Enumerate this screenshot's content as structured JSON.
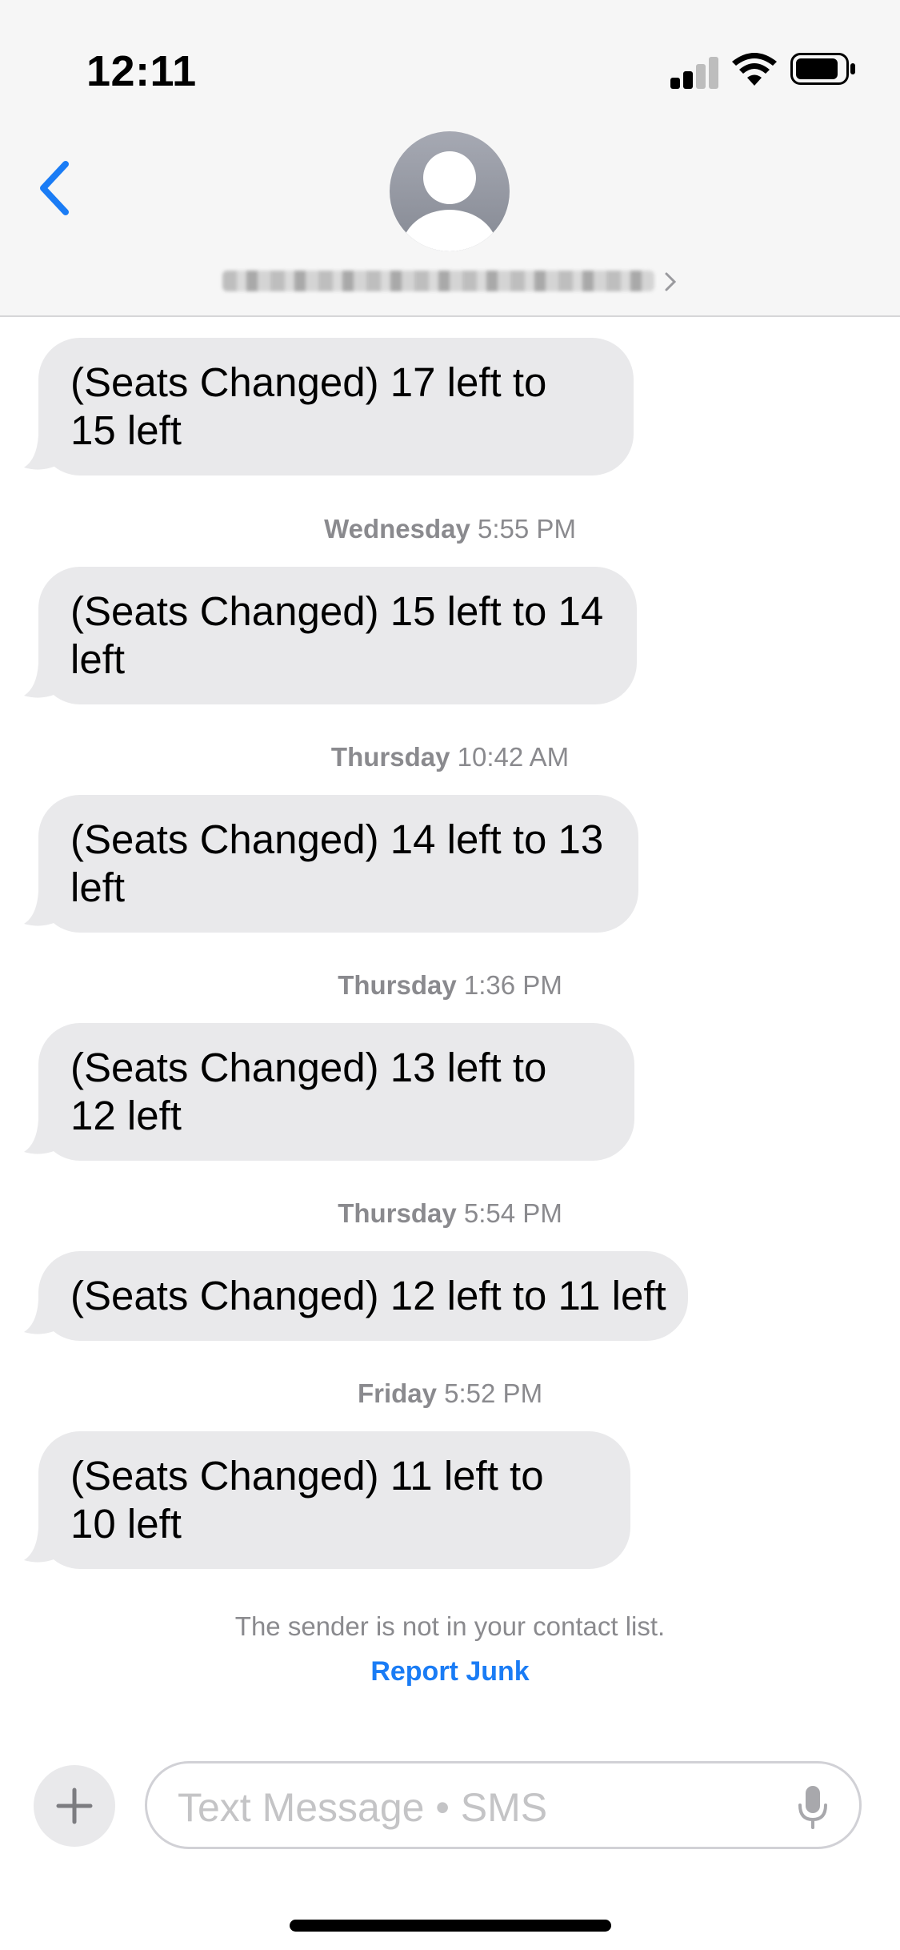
{
  "status_bar": {
    "time": "12:11"
  },
  "header": {
    "contact_name_redacted": true
  },
  "messages": [
    {
      "timestamp_day": "",
      "timestamp_time": "",
      "text": "(Seats Changed) 17 left to 15 left"
    },
    {
      "timestamp_day": "Wednesday",
      "timestamp_time": "5:55 PM",
      "text": "(Seats Changed) 15 left to 14 left"
    },
    {
      "timestamp_day": "Thursday",
      "timestamp_time": "10:42 AM",
      "text": "(Seats Changed) 14 left to 13 left"
    },
    {
      "timestamp_day": "Thursday",
      "timestamp_time": "1:36 PM",
      "text": "(Seats Changed) 13 left to 12 left"
    },
    {
      "timestamp_day": "Thursday",
      "timestamp_time": "5:54 PM",
      "text": "(Seats Changed) 12 left to 11 left"
    },
    {
      "timestamp_day": "Friday",
      "timestamp_time": "5:52 PM",
      "text": "(Seats Changed) 11 left to 10 left"
    }
  ],
  "notice": {
    "text": "The sender is not in your contact list.",
    "report_junk_label": "Report Junk"
  },
  "composer": {
    "placeholder": "Text Message • SMS"
  },
  "colors": {
    "accent": "#1a7cf5",
    "bubble": "#e9e9eb",
    "header_bg": "#f6f6f6"
  }
}
